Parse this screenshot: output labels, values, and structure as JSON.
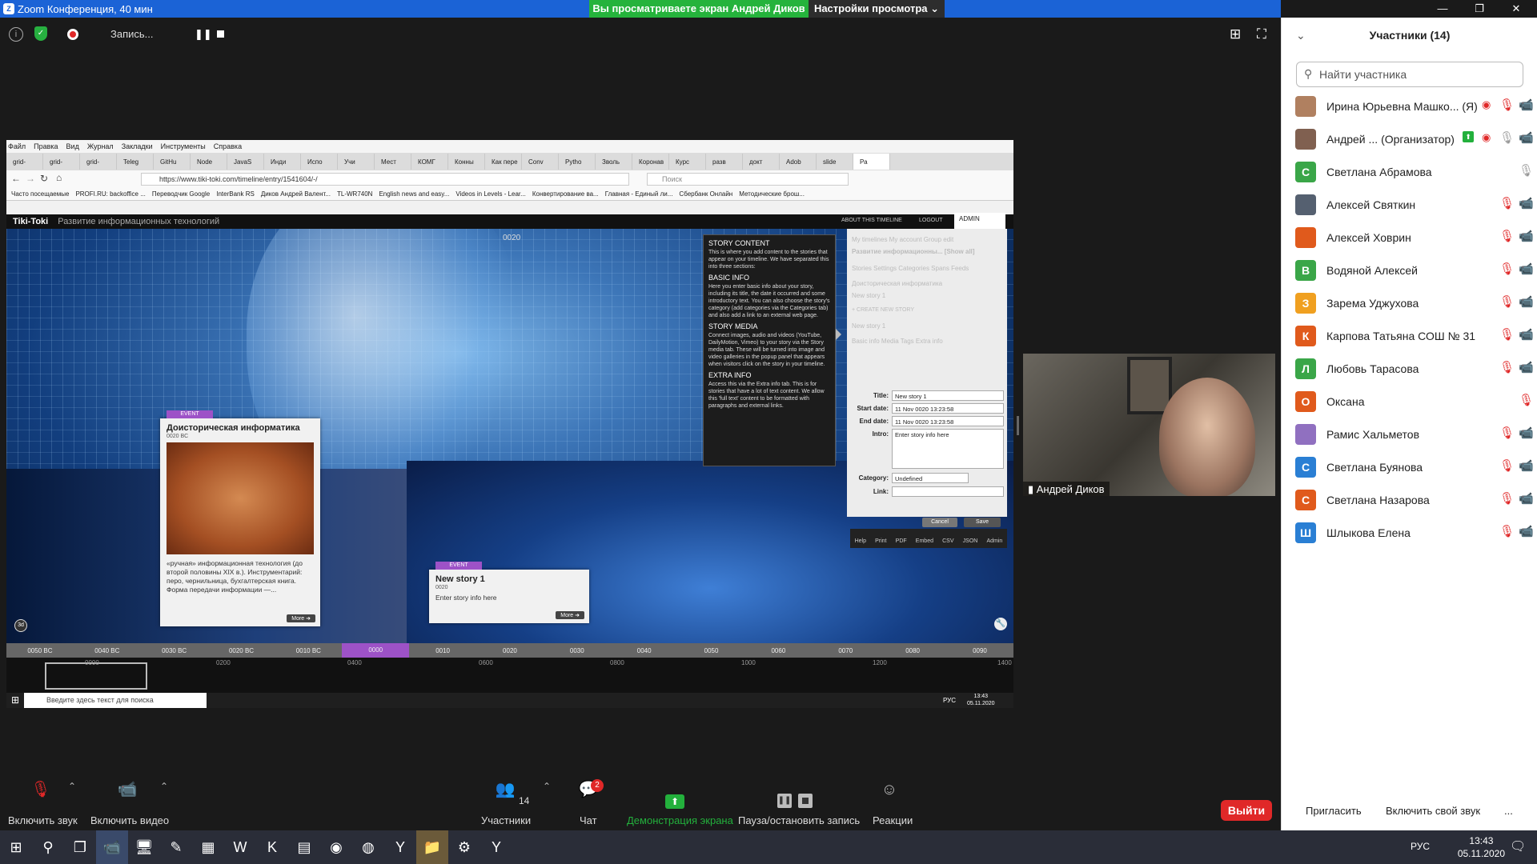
{
  "titlebar": {
    "title": "Zoom Конференция, 40 мин",
    "share_banner": "Вы просматриваете экран Андрей Диков",
    "view_options": "Настройки просмотра ⌄"
  },
  "recording": {
    "label": "Запись..."
  },
  "firefox": {
    "menu": [
      "Файл",
      "Правка",
      "Вид",
      "Журнал",
      "Закладки",
      "Инструменты",
      "Справка"
    ],
    "tabs": [
      "grid-",
      "grid-",
      "grid-",
      "Teleg",
      "GitHu",
      "Node",
      "JavaS",
      "Инди",
      "Испо",
      "Учи",
      "Мест",
      "КОМГ",
      "Конны",
      "Как пере",
      "Conv",
      "Pytho",
      "Зволь",
      "Коронав",
      "Курс",
      "разв",
      "докт",
      "Adob",
      "slide",
      "Ра"
    ],
    "url": "https://www.tiki-toki.com/timeline/entry/1541604/-/",
    "search_placeholder": "Поиск",
    "bookmarks": [
      "Часто посещаемые",
      "PROFI.RU: backoffice ...",
      "Переводчик Google",
      "InterBank RS",
      "Диков Андрей Валент...",
      "TL-WR740N",
      "English news and easy...",
      "Videos in Levels - Lear...",
      "Конвертирование ва...",
      "Главная - Единый ли...",
      "Сбербанк Онлайн",
      "Методические брош..."
    ]
  },
  "tikitoki": {
    "logo": "Tiki-Toki",
    "subtitle": "Развитие информационных технологий",
    "about": "ABOUT THIS TIMELINE",
    "logout": "LOGOUT",
    "admin": "ADMIN",
    "year_label": "0020"
  },
  "event1": {
    "tag": "EVENT",
    "title": "Доисторическая информатика",
    "date": "0020 BC",
    "text": "«ручная» информационная технология (до второй половины XIX в.). Инструментарий: перо, чернильница, бухгалтерская книга. Форма передачи информации —...",
    "more": "More ➜"
  },
  "event2": {
    "tag": "EVENT",
    "title": "New story 1",
    "date": "0020",
    "text": "Enter story info here",
    "more": "More ➜"
  },
  "story_info": {
    "h1": "STORY CONTENT",
    "p1": "This is where you add content to the stories that appear on your timeline. We have separated this into three sections:",
    "h2": "BASIC INFO",
    "p2": "Here you enter basic info about your story, including its title, the date it occurred and some introductory text. You can also choose the story's category (add categories via the Categories tab) and also add a link to an external web page.",
    "h3": "STORY MEDIA",
    "p3": "Connect images, audio and videos (YouTube, DailyMotion, Vimeo) to your story via the Story media tab. These will be turned into image and video galleries in the popup panel that appears when visitors click on the story in your timeline.",
    "h4": "EXTRA INFO",
    "p4": "Access this via the Extra info tab. This is for stories that have a lot of text content. We allow this 'full text' content to be formatted with paragraphs and external links."
  },
  "admin_panel": {
    "tabs_top": "My timelines   My account   Group edit",
    "timeline_name": "Развитие информационны...  [Show all]",
    "tabs_mid": "Stories   Settings   Categories   Spans   Feeds",
    "story_list": [
      "Доисторическая информатика",
      "New story 1"
    ],
    "create": "+ CREATE NEW STORY",
    "story_head": "New story 1",
    "subtabs": "Basic info   Media   Tags   Extra info",
    "title_label": "Title:",
    "title_value": "New story 1",
    "start_label": "Start date:",
    "start_value": "11 Nov 0020 13:23:58",
    "end_label": "End date:",
    "end_value": "11 Nov 0020 13:23:58",
    "intro_label": "Intro:",
    "intro_value": "Enter story info here",
    "category_label": "Category:",
    "category_value": "Undefined",
    "link_label": "Link:",
    "cancel": "Cancel",
    "save": "Save",
    "footer": [
      "Help",
      "Print",
      "PDF",
      "Embed",
      "CSV",
      "JSON",
      "Admin"
    ]
  },
  "timeline": {
    "strip": [
      "0050 BC",
      "0040 BC",
      "0030 BC",
      "0020 BC",
      "0010 BC",
      "0000",
      "0010",
      "0020",
      "0030",
      "0040",
      "0050",
      "0060",
      "0070",
      "0080",
      "0090"
    ],
    "active_index": 5,
    "mini": [
      "0000",
      "0200",
      "0400",
      "0600",
      "0800",
      "1000",
      "1200",
      "1400"
    ]
  },
  "inner_taskbar": {
    "search": "Введите здесь текст для поиска",
    "lang": "РУС",
    "time": "13:43",
    "date": "05.11.2020"
  },
  "video": {
    "name": "Андрей Диков"
  },
  "bottom": {
    "audio": "Включить звук",
    "video": "Включить видео",
    "participants": "Участники",
    "participants_count": "14",
    "chat": "Чат",
    "chat_badge": "2",
    "share": "Демонстрация экрана",
    "record": "Пауза/остановить запись",
    "reactions": "Реакции",
    "leave": "Выйти"
  },
  "panel": {
    "title": "Участники (14)",
    "search_placeholder": "Найти участника",
    "participants": [
      {
        "name": "Ирина Юрьевна Машко... (Я)",
        "initial": "",
        "color": "#b08060"
      },
      {
        "name": "Андрей ... (Организатор)",
        "initial": "",
        "color": "#806050"
      },
      {
        "name": "Светлана Абрамова",
        "initial": "С",
        "color": "#3aa648"
      },
      {
        "name": "Алексей Святкин",
        "initial": "",
        "color": "#556070"
      },
      {
        "name": "Алексей Ховрин",
        "initial": "",
        "color": "#e05a1c"
      },
      {
        "name": "Водяной Алексей",
        "initial": "В",
        "color": "#3aa648"
      },
      {
        "name": "Зарема Уджухова",
        "initial": "З",
        "color": "#f0a020"
      },
      {
        "name": "Карпова Татьяна СОШ № 31",
        "initial": "К",
        "color": "#e05a1c"
      },
      {
        "name": "Любовь Тарасова",
        "initial": "Л",
        "color": "#3aa648"
      },
      {
        "name": "Оксана",
        "initial": "О",
        "color": "#e05a1c"
      },
      {
        "name": "Рамис Хальметов",
        "initial": "",
        "color": "#9070c0"
      },
      {
        "name": "Светлана Буянова",
        "initial": "С",
        "color": "#2a7fd4"
      },
      {
        "name": "Светлана Назарова",
        "initial": "С",
        "color": "#e05a1c"
      },
      {
        "name": "Шлыкова Елена",
        "initial": "Ш",
        "color": "#2a7fd4"
      }
    ],
    "invite": "Пригласить",
    "unmute_me": "Включить свой звук",
    "more": "..."
  },
  "win": {
    "lang": "РУС",
    "time": "13:43",
    "date": "05.11.2020"
  }
}
